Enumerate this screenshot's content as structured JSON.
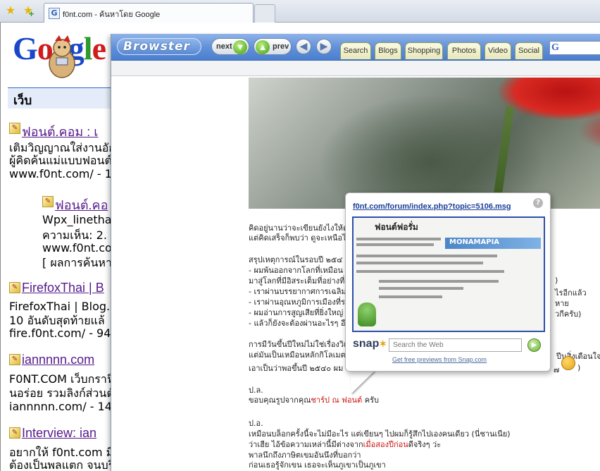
{
  "tab": {
    "title": "f0nt.com - ค้นหาโดย Google"
  },
  "google": {
    "logo": "Google",
    "section": "เว็บ",
    "results": [
      {
        "title": "ฟอนต์.คอม : เ",
        "snippet1": "เติมวิญญาณใส่งานอัก",
        "snippet2": "ผู้คิดค้นแม่แบบฟอนต์ต",
        "url": "www.f0nt.com/ - 18k"
      },
      {
        "title": "ฟอนต์.คอ",
        "snippet1": "Wpx_linethai_",
        "snippet2": "ความเห็น: 2. P",
        "url": "www.f0nt.com/",
        "more": "[ ผลการค้นหาเ"
      },
      {
        "title": "FirefoxThai | B",
        "snippet1": "FirefoxThai | Blog. ...",
        "snippet2": "10 อันดับสุดท้ายแล้",
        "url": "fire.f0nt.com/ - 94k -"
      },
      {
        "title": "iannnnn.com",
        "snippet1": "F0NT.COM เว็บกราฟิ",
        "snippet2": "นอร่อย รวมลิงก์ส่วนตั",
        "url": "iannnnn.com/ - 14k -"
      },
      {
        "title": "Interview: ian",
        "snippet1": "อยากให้ f0nt.com มีไ",
        "snippet2": "ต้องเป็นพลแตก จนบริษั"
      }
    ]
  },
  "overlay": {
    "brand": "Browster",
    "next_label": "next",
    "prev_label": "prev",
    "tabs": [
      "Search",
      "Blogs",
      "Shopping",
      "Photos",
      "Video",
      "Social"
    ]
  },
  "page": {
    "l1": "คิดอยู่นานว่าจะเขียนยังไงให้ดู",
    "l2": "แต่คิดเสร็จก็พบว่า ดูจะเหนือไ",
    "l3": "สรุปเหตุการณ์ในรอบปี ๒๕๔",
    "l4": "- ผมพ้นออกจากโลกที่เหมือน",
    "l5": "มาสู่โลกที่มีอิสระเต็มที่อย่างที่",
    "l6": "- เราผ่านบรรยากาศการเฉลิม",
    "l7": "- เราผ่านอุณหภูมิการเมืองที่ร",
    "l8": "- ผมอ่านการสูญเสียที่ยิ่งใหญ่",
    "l9": "- แล้วก็ยังจะต้องผ่านอะไรๆ อี",
    "l10": "การมีวันขึ้นปีใหม่ไม่ใช่เรื่องวิเ",
    "l11": "แต่มันเป็นเหมือนหลักกิโลเมต",
    "l12": "เอาเป็นว่าพอขึ้นปี ๒๕๔๐ ผม",
    "r1": ")",
    "r2": "ไรอีกแล้ว",
    "r3": "หาย",
    "r4": "วกีครับ)",
    "r5": "ปีนสิ่งเตือนใจ",
    "r6": "๗",
    "r7": ")",
    "ps1": "ป.ล.",
    "ps1_line_a": "ขอบคุณรูปจากคุณ",
    "ps1_line_b": "ชาร์ป ณ ฟอนต์",
    "ps1_line_c": " ครับ",
    "ps2": "ป.อ.",
    "p1": "เหมือนบล็อกครั้งนี้จะไม่มีอะไร แต่เขียนๆ ไปผมก็รู้สึกไปเองคนเดียว (นี่ชานเนีย)",
    "p2a": "ว่าเฮีย ไอ้ข้อความเหล่านี้มีต่างจาก",
    "p2b": "เมื่อสองปีก่อน",
    "p2c": "ดีจริงๆ ว่ะ",
    "p3": "พาลนึกถึงภาษิตเขมอันนึงที่บอกว่า",
    "p4": "ก่อนเธอรู้จักเขน เธอจะเห็นภูเขาเป็นภูเขา"
  },
  "snap": {
    "url": "f0nt.com/forum/index.php?topic=5106.msg",
    "help": "?",
    "thumb_title": "ฟอนต์ฟอรั่ม",
    "thumb_banner": "MONAMAPIA",
    "logo": "snap",
    "search_placeholder": "Search the Web",
    "footer": "Get free previews from Snap.com"
  }
}
